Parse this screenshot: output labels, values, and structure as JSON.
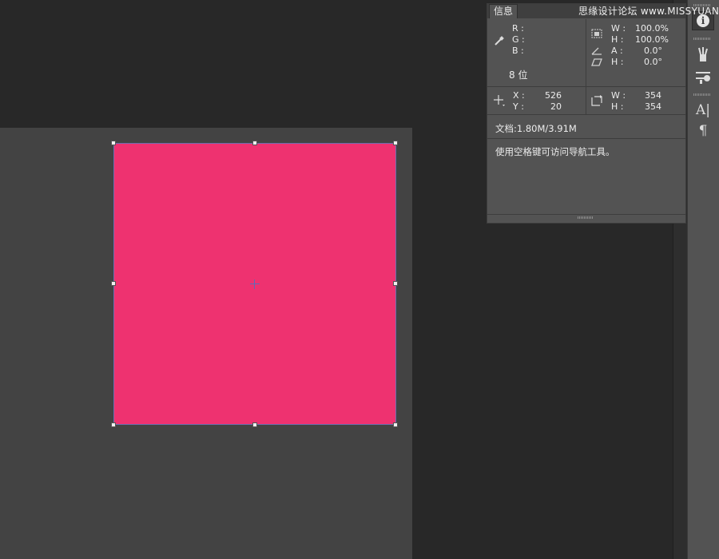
{
  "panel": {
    "tab_label": "信息",
    "watermark": "思缘设计论坛 www.MISSYUAN.COM",
    "color": {
      "r_label": "R :",
      "g_label": "G :",
      "b_label": "B :",
      "bits": "8 位"
    },
    "size": {
      "w_label": "W :",
      "w_value": "100.0%",
      "h_label": "H :",
      "h_value": "100.0%",
      "angle_label": "A :",
      "angle_value": "0.0°",
      "skew_label": "H :",
      "skew_value": "0.0°"
    },
    "position": {
      "x_label": "X :",
      "x_value": "526",
      "y_label": "Y :",
      "y_value": "20",
      "w_label": "W :",
      "w_value": "354",
      "h_label": "H :",
      "h_value": "354"
    },
    "doc_info": "文档:1.80M/3.91M",
    "hint": "使用空格键可访问导航工具。"
  },
  "toolbar": {
    "buttons": [
      {
        "icon": "info-icon",
        "glyph": "i"
      },
      {
        "icon": "brush-presets-icon",
        "glyph": "✎"
      },
      {
        "icon": "brush-settings-icon",
        "glyph": "⚌"
      },
      {
        "icon": "character-icon",
        "glyph": "A|"
      },
      {
        "icon": "paragraph-icon",
        "glyph": "¶"
      }
    ]
  },
  "canvas": {
    "shape_fill": "#ee3270",
    "document_bg": "#434343",
    "workspace_bg": "#282828"
  }
}
